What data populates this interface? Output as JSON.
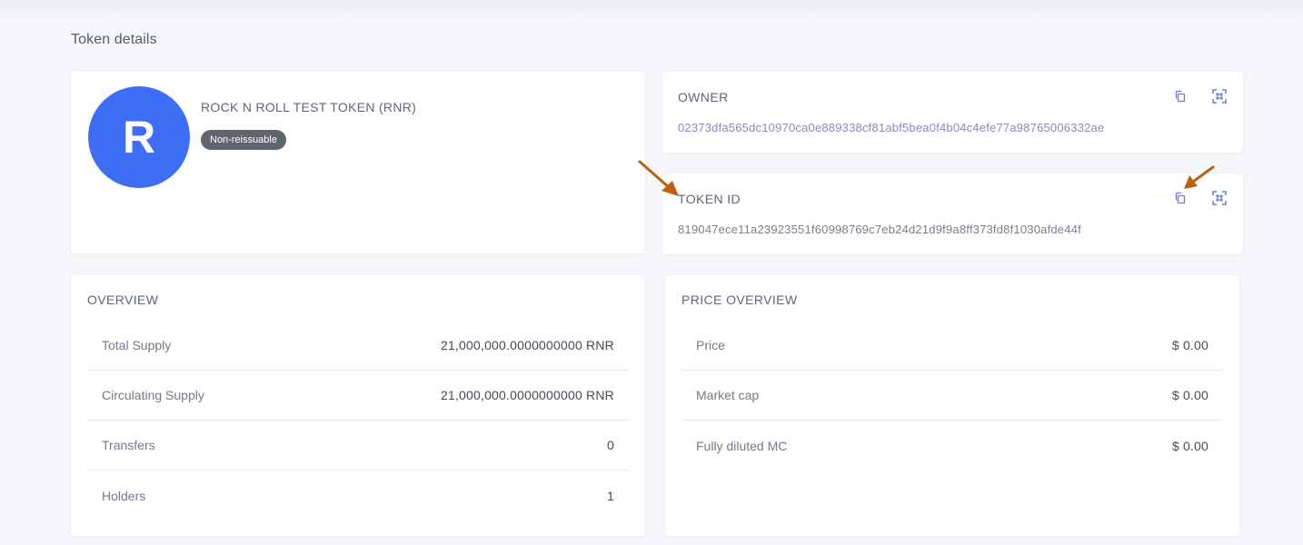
{
  "page": {
    "title": "Token details"
  },
  "token": {
    "avatar_letter": "R",
    "name": "ROCK N ROLL TEST TOKEN (RNR)",
    "badge": "Non-reissuable"
  },
  "owner": {
    "label": "OWNER",
    "value": "02373dfa565dc10970ca0e889338cf81abf5bea0f4b04c4efe77a98765006332ae",
    "copy_icon": "copy-icon",
    "qr_icon": "qr-scan-icon"
  },
  "token_id": {
    "label": "TOKEN ID",
    "value": "819047ece11a23923551f60998769c7eb24d21d9f9a8ff373fd8f1030afde44f",
    "copy_icon": "copy-icon",
    "qr_icon": "qr-scan-icon"
  },
  "overview": {
    "title": "OVERVIEW",
    "rows": [
      {
        "label": "Total Supply",
        "value": "21,000,000.0000000000 RNR"
      },
      {
        "label": "Circulating Supply",
        "value": "21,000,000.0000000000 RNR"
      },
      {
        "label": "Transfers",
        "value": "0"
      },
      {
        "label": "Holders",
        "value": "1"
      }
    ]
  },
  "price_overview": {
    "title": "PRICE OVERVIEW",
    "rows": [
      {
        "label": "Price",
        "value": "$ 0.00"
      },
      {
        "label": "Market cap",
        "value": "$ 0.00"
      },
      {
        "label": "Fully diluted MC",
        "value": "$ 0.00"
      }
    ]
  },
  "colors": {
    "accent": "#3d6ef5",
    "icon": "#6f7ad6",
    "annotation_arrow": "#b8620e",
    "page_bg": "#f6f7fb"
  }
}
